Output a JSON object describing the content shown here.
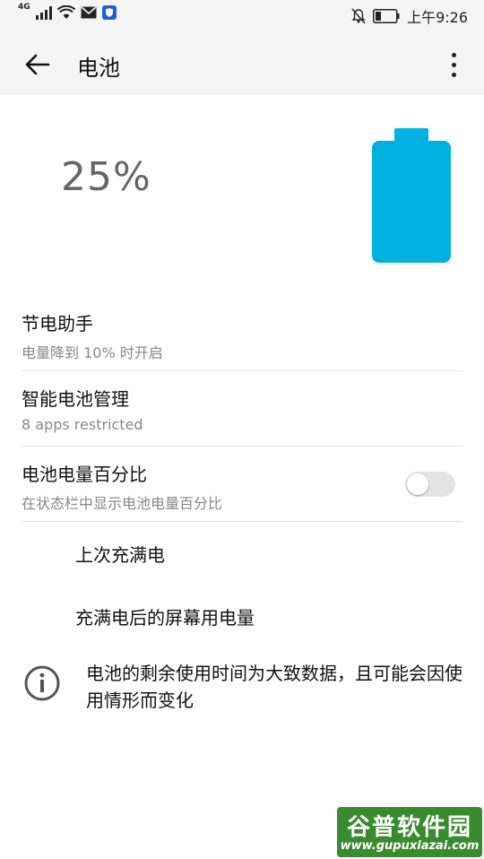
{
  "status_bar": {
    "network": "4G",
    "time": "上午9:26",
    "icons": [
      "signal-icon",
      "wifi-icon",
      "mail-icon",
      "shield-app-icon",
      "notifications-off-icon",
      "battery-icon"
    ]
  },
  "toolbar": {
    "back_icon": "arrow-left-icon",
    "title": "电池",
    "more_icon": "more-vert-icon"
  },
  "battery": {
    "percent_text": "25%",
    "level": 0.25,
    "color": "#00b1e0"
  },
  "settings": [
    {
      "title": "节电助手",
      "subtitle": "电量降到 10% 时开启"
    },
    {
      "title": "智能电池管理",
      "subtitle": "8 apps restricted"
    },
    {
      "title": "电池电量百分比",
      "subtitle": "在状态栏中显示电池电量百分比",
      "toggle": false
    }
  ],
  "items": [
    {
      "label": "上次充满电"
    },
    {
      "label": "充满电后的屏幕用电量"
    }
  ],
  "info": {
    "icon": "info-icon",
    "text": "电池的剩余使用时间为大致数据，且可能会因使用情形而变化"
  },
  "watermark": {
    "title": "谷普软件园",
    "url": "www.gupuxiazai.com"
  }
}
